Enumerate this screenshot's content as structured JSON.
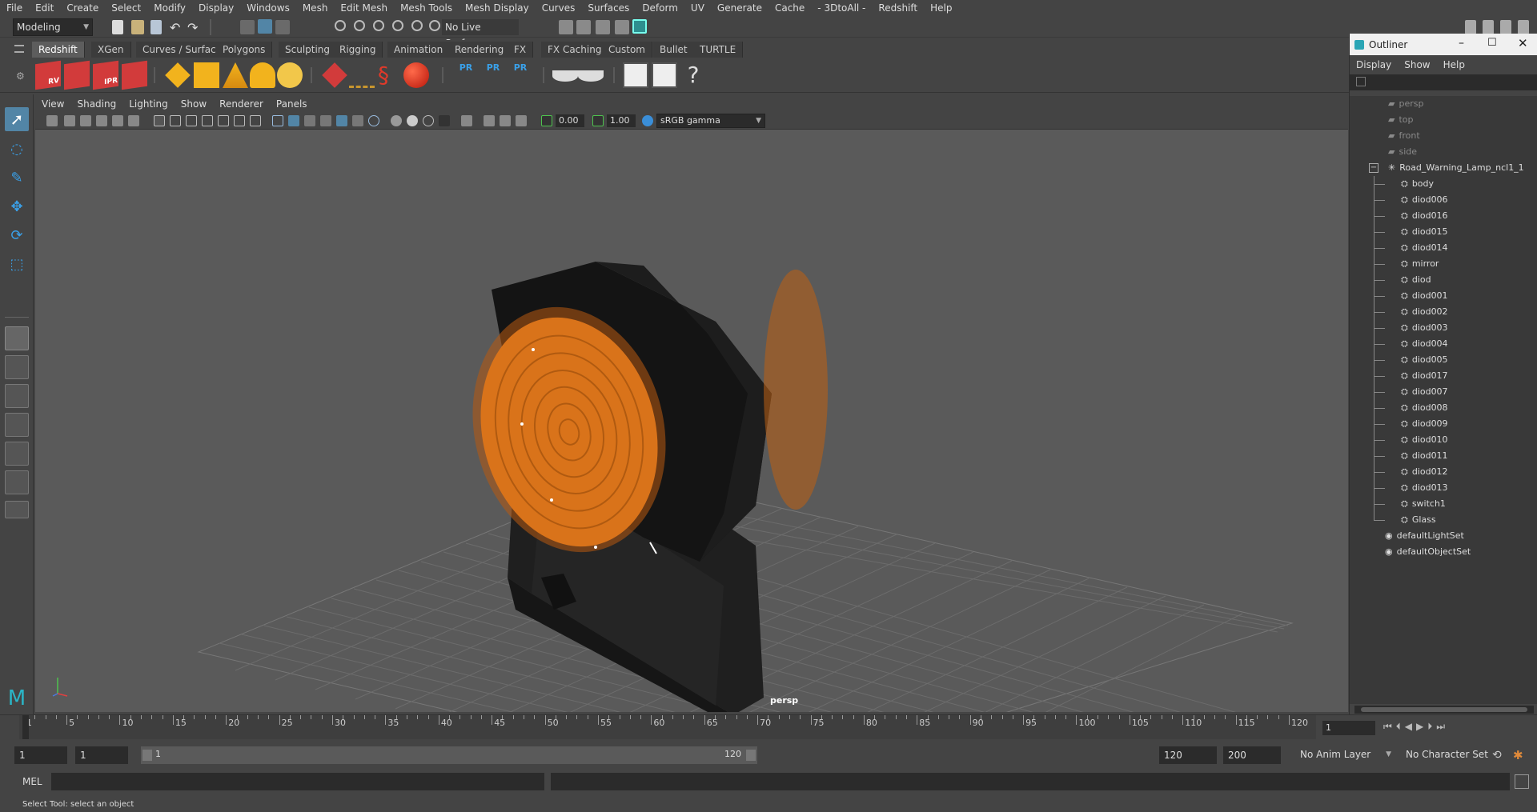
{
  "menubar": {
    "items": [
      "File",
      "Edit",
      "Create",
      "Select",
      "Modify",
      "Display",
      "Windows",
      "Mesh",
      "Edit Mesh",
      "Mesh Tools",
      "Mesh Display",
      "Curves",
      "Surfaces",
      "Deform",
      "UV",
      "Generate",
      "Cache",
      "- 3DtoAll -",
      "Redshift",
      "Help"
    ]
  },
  "statusline": {
    "mode": "Modeling",
    "live_surface": "No Live Surface"
  },
  "shelf": {
    "tabs": [
      "Redshift",
      "XGen",
      "Curves / Surfaces",
      "Polygons",
      "Sculpting",
      "Rigging",
      "Animation",
      "Rendering",
      "FX",
      "FX Caching",
      "Custom",
      "Bullet",
      "TURTLE"
    ],
    "active_tab": "Redshift",
    "icon_labels": [
      "RV",
      "IPR",
      "PR",
      "PR",
      "PR"
    ]
  },
  "viewport": {
    "menu": [
      "View",
      "Shading",
      "Lighting",
      "Show",
      "Renderer",
      "Panels"
    ],
    "exposure": "0.00",
    "gamma": "1.00",
    "color_space": "sRGB gamma",
    "camera_label": "persp"
  },
  "outliner": {
    "title": "Outliner",
    "menu": [
      "Display",
      "Show",
      "Help"
    ],
    "cameras": [
      "persp",
      "top",
      "front",
      "side"
    ],
    "group": "Road_Warning_Lamp_ncl1_1",
    "children": [
      "body",
      "diod006",
      "diod016",
      "diod015",
      "diod014",
      "mirror",
      "diod",
      "diod001",
      "diod002",
      "diod003",
      "diod004",
      "diod005",
      "diod017",
      "diod007",
      "diod008",
      "diod009",
      "diod010",
      "diod011",
      "diod012",
      "diod013",
      "switch1",
      "Glass"
    ],
    "sets": [
      "defaultLightSet",
      "defaultObjectSet"
    ]
  },
  "timeline": {
    "ticks": [
      "1",
      "5",
      "10",
      "15",
      "20",
      "25",
      "30",
      "35",
      "40",
      "45",
      "50",
      "55",
      "60",
      "65",
      "70",
      "75",
      "80",
      "85",
      "90",
      "95",
      "100",
      "105",
      "110",
      "115",
      "120"
    ],
    "current_frame": "1"
  },
  "range": {
    "start": "1",
    "start2": "1",
    "slider_start": "1",
    "slider_end": "120",
    "end": "120",
    "end2": "200",
    "anim_layer": "No Anim Layer",
    "character_set": "No Character Set"
  },
  "cmd": {
    "lang": "MEL"
  },
  "help": {
    "text": "Select Tool: select an object"
  },
  "colors": {
    "accent": "#5285a6",
    "lamp": "#d9731a"
  }
}
